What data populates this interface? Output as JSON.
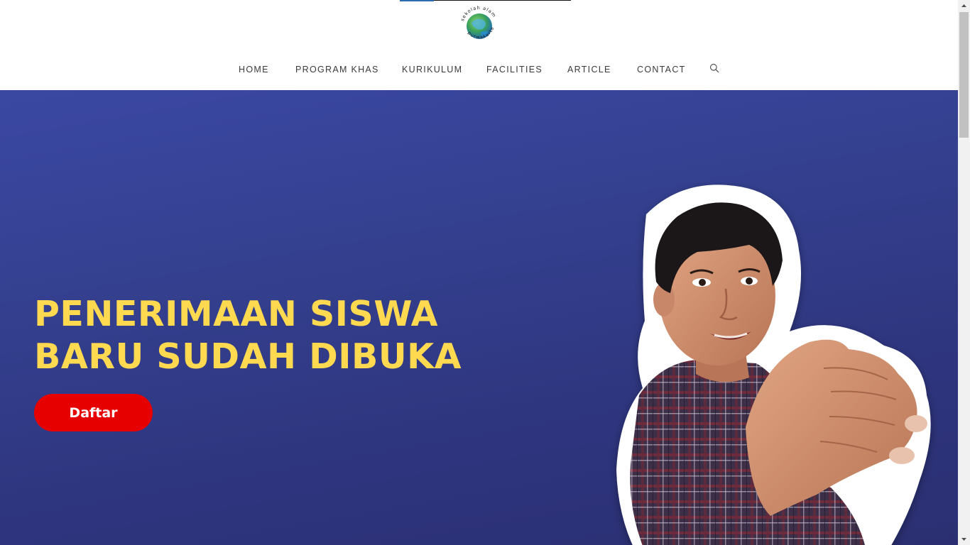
{
  "header": {
    "logo_text": "sekolah alam purwakarta",
    "nav": [
      {
        "label": "HOME"
      },
      {
        "label": "PROGRAM KHAS"
      },
      {
        "label": "KURIKULUM"
      },
      {
        "label": "FACILITIES"
      },
      {
        "label": "ARTICLE"
      },
      {
        "label": "CONTACT"
      }
    ],
    "search_icon": "search-icon"
  },
  "hero": {
    "headline_line1": "PENERIMAAN SISWA",
    "headline_line2": "BARU SUDAH DIBUKA",
    "cta_label": "Daftar",
    "photo": "child-extending-hand-photo"
  },
  "colors": {
    "hero_background": "#34408f",
    "headline": "#ffd94f",
    "cta_background": "#e60000",
    "cta_text": "#ffffff",
    "nav_text": "#3a3a3a"
  }
}
